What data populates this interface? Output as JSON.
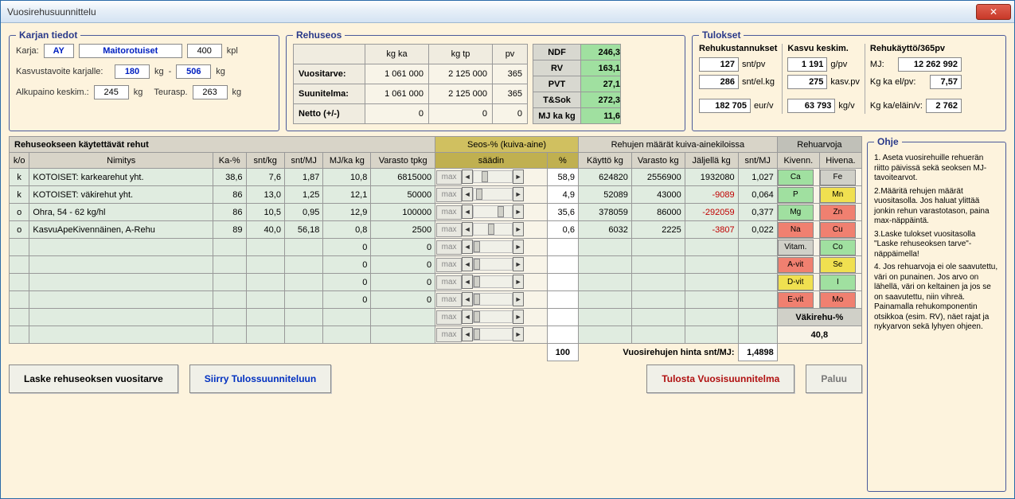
{
  "window_title": "Vuosirehusuunnittelu",
  "karja": {
    "legend": "Karjan tiedot",
    "label_karja": "Karja:",
    "breed_code": "AY",
    "breed_name": "Maitorotuiset",
    "count": "400",
    "count_unit": "kpl",
    "label_kasvu": "Kasvustavoite karjalle:",
    "kasvu_min": "180",
    "kasvu_max": "506",
    "kg": "kg",
    "dash": "-",
    "label_alku": "Alkupaino keskim.:",
    "alku_val": "245",
    "label_teurasp": "Teurasp.",
    "teurasp_val": "263"
  },
  "rehuseos": {
    "legend": "Rehuseos",
    "headers": {
      "kgka": "kg ka",
      "kgtp": "kg tp",
      "pv": "pv"
    },
    "rows": [
      {
        "label": "Vuositarve:",
        "kgka": "1 061 000",
        "kgtp": "2 125 000",
        "pv": "365"
      },
      {
        "label": "Suunitelma:",
        "kgka": "1 061 000",
        "kgtp": "2 125 000",
        "pv": "365"
      },
      {
        "label": "Netto (+/-)",
        "kgka": "0",
        "kgtp": "0",
        "pv": "0"
      }
    ],
    "nutri": [
      {
        "label": "NDF",
        "val": "246,3"
      },
      {
        "label": "RV",
        "val": "163,1"
      },
      {
        "label": "PVT",
        "val": "27,1"
      },
      {
        "label": "T&Sok",
        "val": "272,3"
      },
      {
        "label": "MJ ka kg",
        "val": "11,6"
      }
    ]
  },
  "tulokset": {
    "legend": "Tulokset",
    "cols": [
      {
        "hdr": "Rehukustannukset",
        "rows": [
          {
            "val": "127",
            "unit": "snt/pv"
          },
          {
            "val": "286",
            "unit": "snt/el.kg"
          },
          {
            "val": "182 705",
            "unit": "eur/v"
          }
        ]
      },
      {
        "hdr": "Kasvu keskim.",
        "rows": [
          {
            "val": "1 191",
            "unit": "g/pv"
          },
          {
            "val": "275",
            "unit": "kasv.pv"
          },
          {
            "val": "63 793",
            "unit": "kg/v"
          }
        ]
      },
      {
        "hdr": "Rehukäyttö/365pv",
        "rows": [
          {
            "label": "MJ:",
            "val": "12 262 992"
          },
          {
            "label": "Kg ka el/pv:",
            "val": "7,57"
          },
          {
            "label": "Kg ka/eläin/v:",
            "val": "2 762"
          }
        ]
      }
    ]
  },
  "grid": {
    "title": "Rehuseokseen käytettävät rehut",
    "seos_hdr": "Seos-%  (kuiva-aine)",
    "rehumaara_hdr": "Rehujen määrät kuiva-ainekiloissa",
    "rehuarvot_hdr": "Rehuarvoja",
    "cols": {
      "ko": "k/o",
      "nimitys": "Nimitys",
      "ka": "Ka-%",
      "sntkg": "snt/kg",
      "sntmj": "snt/MJ",
      "mjka": "MJ/ka kg",
      "varasto": "Varasto tpkg",
      "saadin": "säädin",
      "pct": "%",
      "kaytto": "Käyttö kg",
      "varastokg": "Varasto kg",
      "jaljella": "Jäljellä kg",
      "sntmj2": "snt/MJ",
      "kivenn": "Kivenn.",
      "hivena": "Hivena."
    },
    "max_label": "max",
    "rows": [
      {
        "ko": "k",
        "nimitys": "KOTOISET: karkearehut yht.",
        "ka": "38,6",
        "sntkg": "7,6",
        "sntmj": "1,87",
        "mjka": "10,8",
        "varasto": "6815000",
        "pct": "58,9",
        "kaytto": "624820",
        "varastokg": "2556900",
        "jaljella": "1932080",
        "sntmj2": "1,027",
        "thumb": 10
      },
      {
        "ko": "k",
        "nimitys": "KOTOISET: väkirehut yht.",
        "ka": "86",
        "sntkg": "13,0",
        "sntmj": "1,25",
        "mjka": "12,1",
        "varasto": "50000",
        "pct": "4,9",
        "kaytto": "52089",
        "varastokg": "43000",
        "jaljella": "-9089",
        "sntmj2": "0,064",
        "thumb": 3
      },
      {
        "ko": "o",
        "nimitys": "Ohra, 54 - 62 kg/hl",
        "ka": "86",
        "sntkg": "10,5",
        "sntmj": "0,95",
        "mjka": "12,9",
        "varasto": "100000",
        "pct": "35,6",
        "kaytto": "378059",
        "varastokg": "86000",
        "jaljella": "-292059",
        "sntmj2": "0,377",
        "thumb": 30
      },
      {
        "ko": "o",
        "nimitys": "KasvuApeKivennäinen, A-Rehu",
        "ka": "89",
        "sntkg": "40,0",
        "sntmj": "56,18",
        "mjka": "0,8",
        "varasto": "2500",
        "pct": "0,6",
        "kaytto": "6032",
        "varastokg": "2225",
        "jaljella": "-3807",
        "sntmj2": "0,022",
        "thumb": 18
      },
      {
        "ko": "",
        "nimitys": "",
        "ka": "",
        "sntkg": "",
        "sntmj": "",
        "mjka": "0",
        "varasto": "0",
        "pct": "",
        "kaytto": "",
        "varastokg": "",
        "jaljella": "",
        "sntmj2": "",
        "thumb": 0
      },
      {
        "ko": "",
        "nimitys": "",
        "ka": "",
        "sntkg": "",
        "sntmj": "",
        "mjka": "0",
        "varasto": "0",
        "pct": "",
        "kaytto": "",
        "varastokg": "",
        "jaljella": "",
        "sntmj2": "",
        "thumb": 0
      },
      {
        "ko": "",
        "nimitys": "",
        "ka": "",
        "sntkg": "",
        "sntmj": "",
        "mjka": "0",
        "varasto": "0",
        "pct": "",
        "kaytto": "",
        "varastokg": "",
        "jaljella": "",
        "sntmj2": "",
        "thumb": 0
      },
      {
        "ko": "",
        "nimitys": "",
        "ka": "",
        "sntkg": "",
        "sntmj": "",
        "mjka": "0",
        "varasto": "0",
        "pct": "",
        "kaytto": "",
        "varastokg": "",
        "jaljella": "",
        "sntmj2": "",
        "thumb": 0
      },
      {
        "ko": "",
        "nimitys": "",
        "ka": "",
        "sntkg": "",
        "sntmj": "",
        "mjka": "",
        "varasto": "",
        "pct": "",
        "kaytto": "",
        "varastokg": "",
        "jaljella": "",
        "sntmj2": "",
        "thumb": 0
      },
      {
        "ko": "",
        "nimitys": "",
        "ka": "",
        "sntkg": "",
        "sntmj": "",
        "mjka": "",
        "varasto": "",
        "pct": "",
        "kaytto": "",
        "varastokg": "",
        "jaljella": "",
        "sntmj2": "",
        "thumb": 0
      }
    ],
    "total_pct": "100",
    "price_label": "Vuosirehujen hinta snt/MJ:",
    "price_val": "1,4898",
    "nutri_buttons": [
      {
        "l": "Ca",
        "lc": "g-green",
        "r": "Fe",
        "rc": "g-gray"
      },
      {
        "l": "P",
        "lc": "g-green",
        "r": "Mn",
        "rc": "g-yellow"
      },
      {
        "l": "Mg",
        "lc": "g-green",
        "r": "Zn",
        "rc": "g-red"
      },
      {
        "l": "Na",
        "lc": "g-red",
        "r": "Cu",
        "rc": "g-red"
      },
      {
        "l": "Vitam.",
        "lc": "g-gray",
        "r": "Co",
        "rc": "g-green"
      },
      {
        "l": "A-vit",
        "lc": "g-red",
        "r": "Se",
        "rc": "g-yellow"
      },
      {
        "l": "D-vit",
        "lc": "g-yellow",
        "r": "I",
        "rc": "g-green"
      },
      {
        "l": "E-vit",
        "lc": "g-red",
        "r": "Mo",
        "rc": "g-red"
      }
    ],
    "vakirehu_label": "Väkirehu-%",
    "vakirehu_val": "40,8"
  },
  "ohje": {
    "legend": "Ohje",
    "p1": "1. Aseta vuosirehuille rehuerän riitto päivissä sekä seoksen MJ- tavoitearvot.",
    "p2": "2.Määritä rehujen määrät vuositasolla. Jos haluat ylittää jonkin rehun varastotason, paina max-näppäintä.",
    "p3": "3.Laske tulokset vuositasolla \"Laske rehuseoksen tarve\"-näppäimella!",
    "p4": "4. Jos rehuarvoja ei ole saavutettu, väri on punainen. Jos arvo on lähellä, väri on keltainen ja jos se on saavutettu, niin vihreä. Painamalla rehukomponentin otsikkoa (esim. RV), näet rajat ja nykyarvon sekä lyhyen ohjeen."
  },
  "buttons": {
    "laske": "Laske rehuseoksen vuositarve",
    "siirry": "Siirry  Tulossuunniteluun",
    "tulosta": "Tulosta Vuosisuunnitelma",
    "paluu": "Paluu"
  }
}
